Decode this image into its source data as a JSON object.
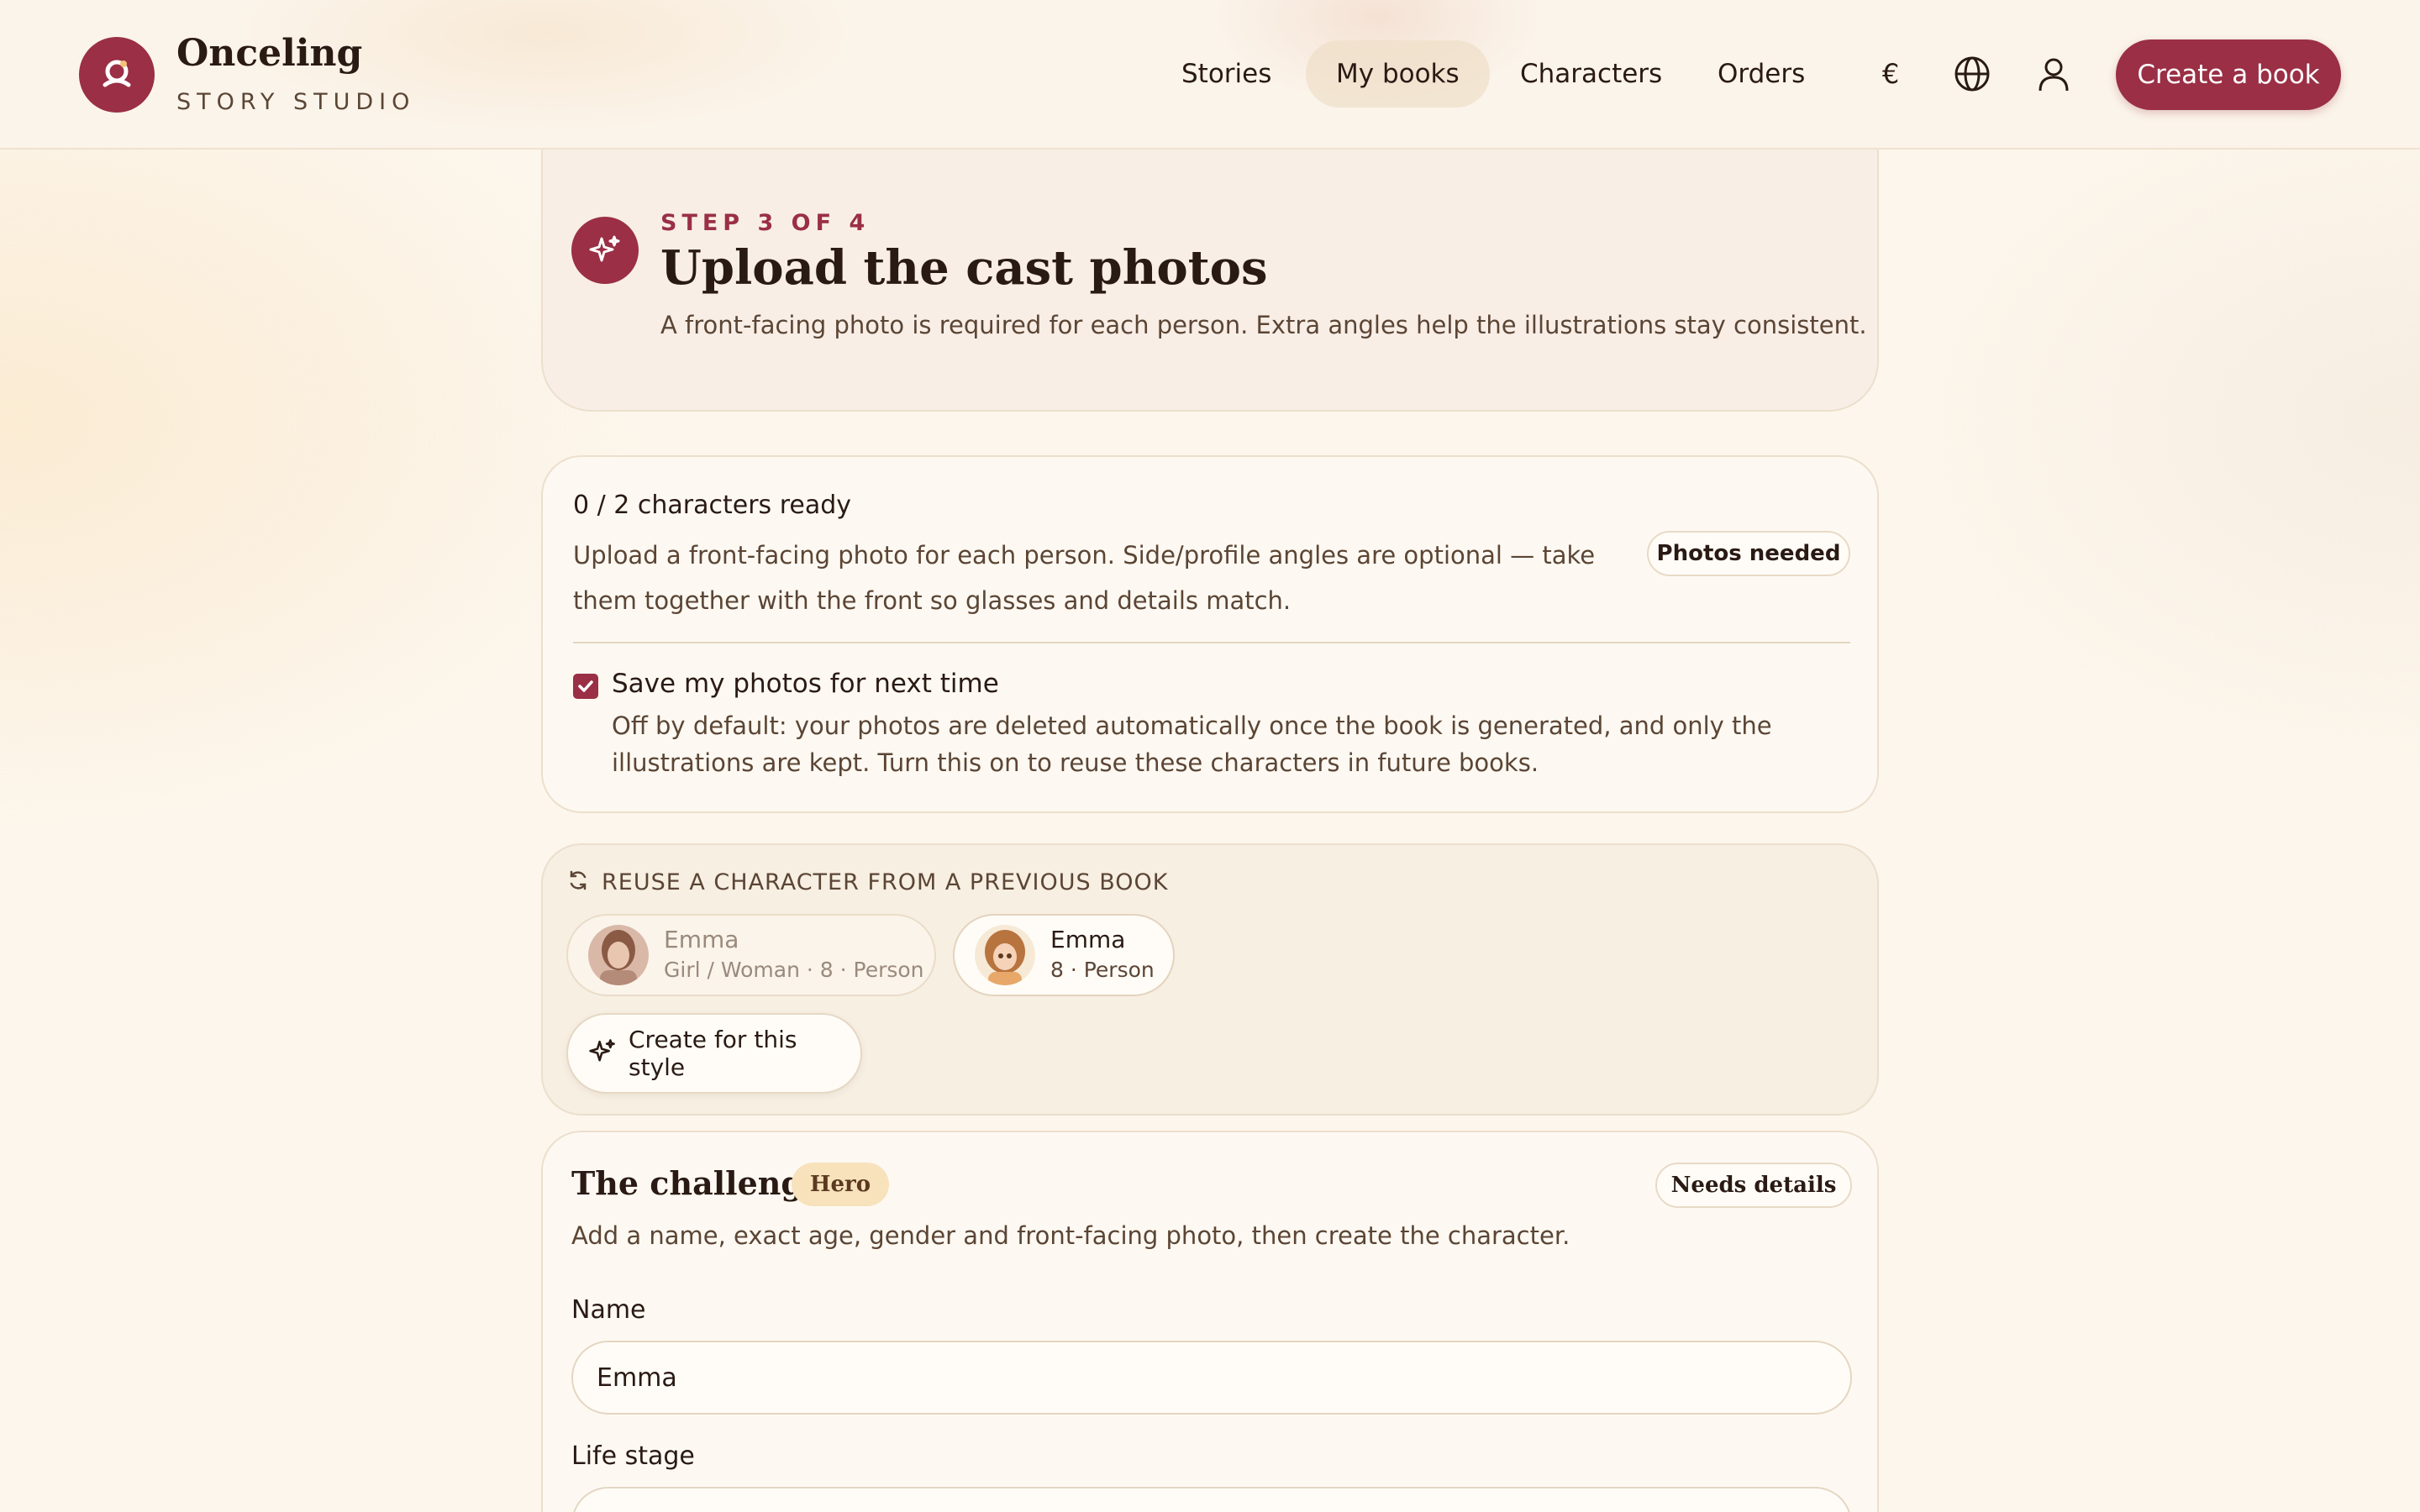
{
  "brand": {
    "name": "Onceling",
    "subtitle": "STORY STUDIO"
  },
  "nav": {
    "items": [
      {
        "label": "Stories"
      },
      {
        "label": "My books"
      },
      {
        "label": "Characters"
      },
      {
        "label": "Orders"
      }
    ],
    "currency_symbol": "€",
    "cta_label": "Create a book"
  },
  "step": {
    "label": "STEP 3 OF 4",
    "title": "Upload the cast photos",
    "description": "A front-facing photo is required for each person. Extra angles help the illustrations stay consistent."
  },
  "ready": {
    "title": "0 / 2 characters ready",
    "description": "Upload a front-facing photo for each person. Side/profile angles are optional — take them together with the front so glasses and details match.",
    "badge": "Photos needed",
    "save_title": "Save my photos for next time",
    "save_checked": true,
    "save_description": "Off by default: your photos are deleted automatically once the book is generated, and only the illustrations are kept. Turn this on to reuse these characters in future books."
  },
  "reuse": {
    "title": "REUSE A CHARACTER FROM A PREVIOUS BOOK",
    "characters": [
      {
        "name": "Emma",
        "meta": "Girl / Woman · 8 · Person"
      },
      {
        "name": "Emma",
        "meta": "8 · Person"
      }
    ],
    "create_label": "Create for this style"
  },
  "challenger": {
    "title": "The challenger",
    "role_badge": "Hero",
    "status_badge": "Needs details",
    "description": "Add a name, exact age, gender and front-facing photo, then create the character.",
    "name_label": "Name",
    "name_value": "Emma",
    "life_stage_label": "Life stage"
  },
  "colors": {
    "accent": "#9a2f45",
    "background": "#fcf6ec",
    "hero_badge": "#f7e2bc"
  }
}
